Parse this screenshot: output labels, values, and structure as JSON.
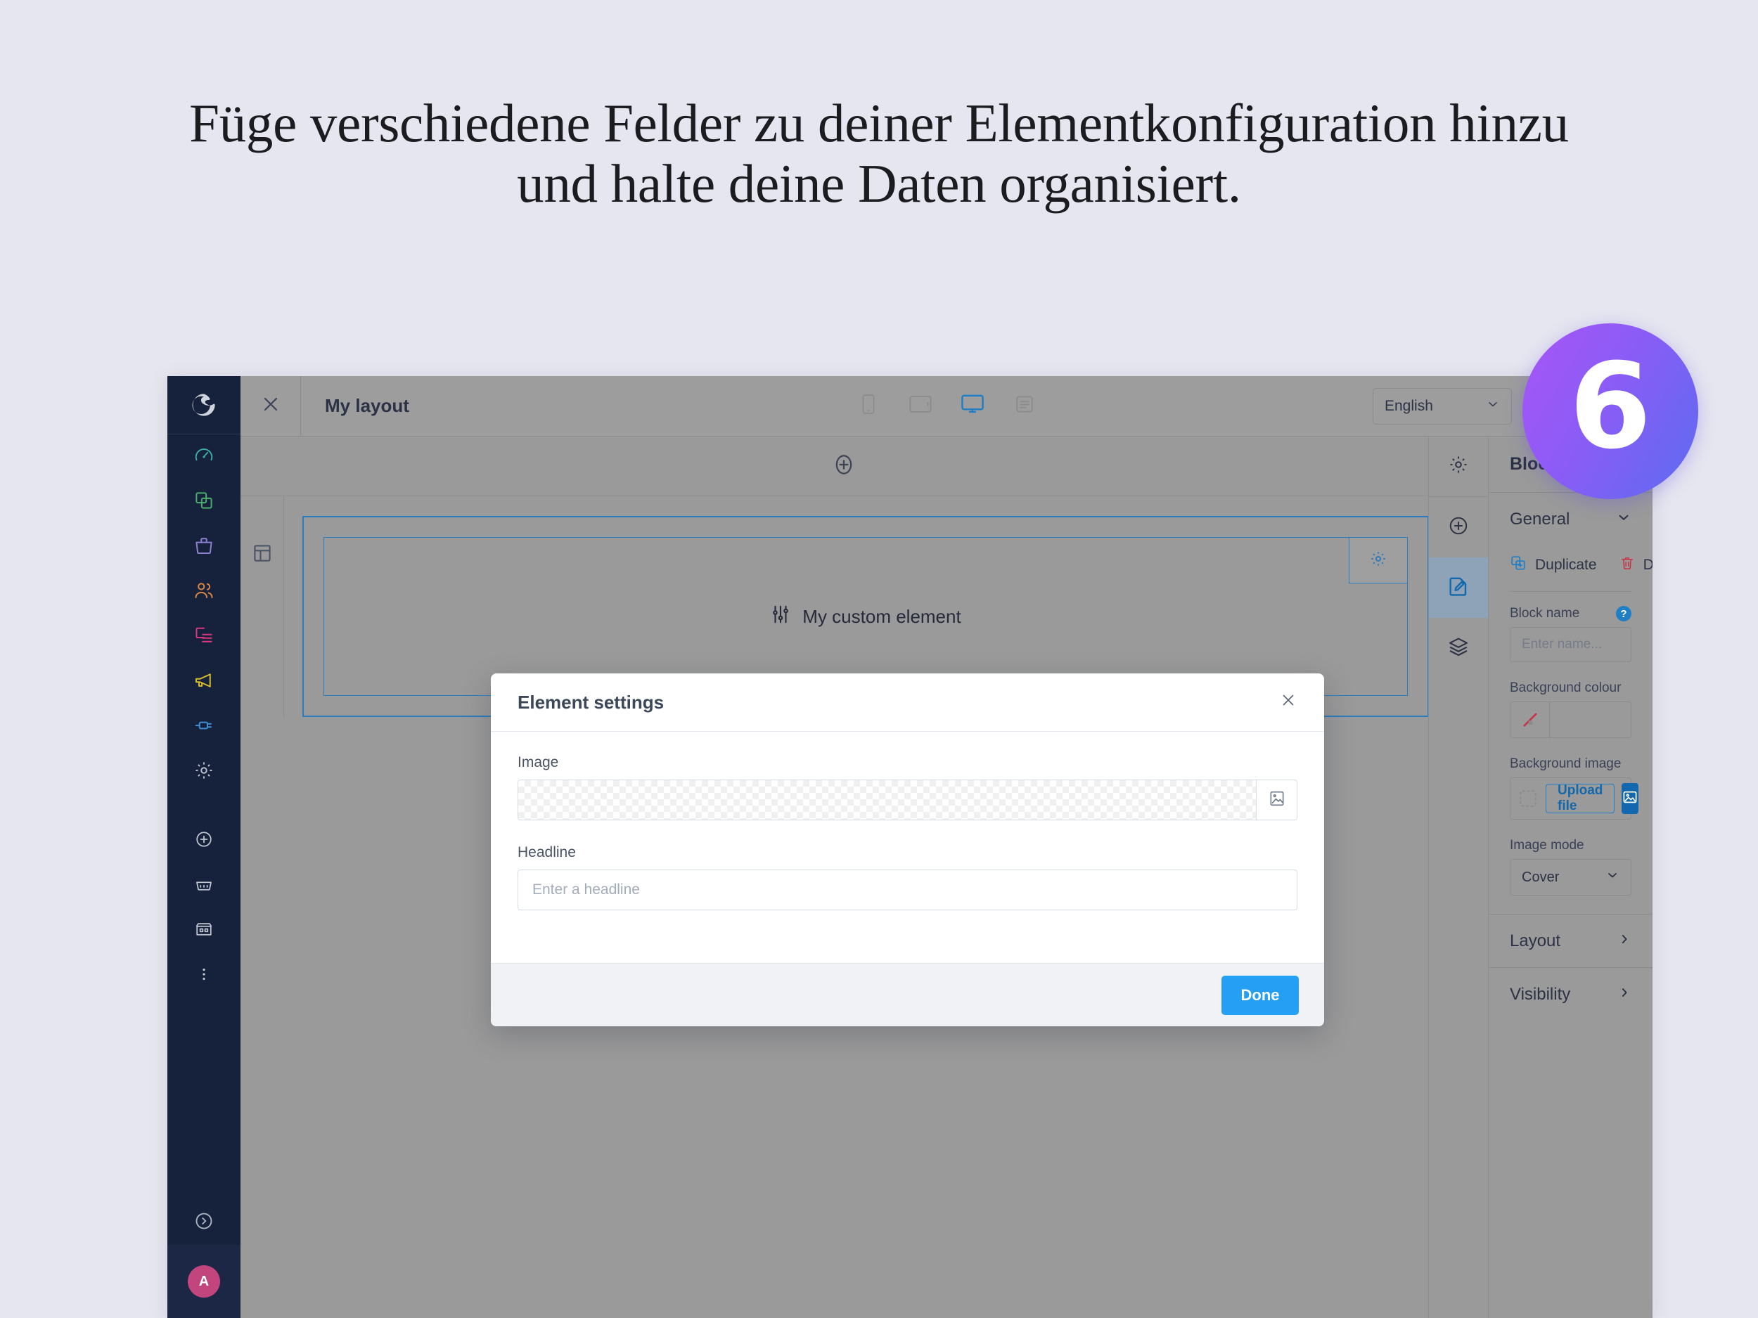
{
  "headline": "Füge verschiedene Felder zu deiner Elementkonfiguration hinzu und halte deine Daten organisiert.",
  "badge": {
    "version": "6"
  },
  "colors": {
    "page_background": "#e6e6f0",
    "sidebar": "#16223c",
    "overlay_grey": "#9a9a9a",
    "accent_blue": "#1f7ec4",
    "primary_button": "#259ff4",
    "save_button": "#0b6db8",
    "danger_red": "#c7344a",
    "avatar": "#c2467d",
    "badge_gradient_from": "#a855f7",
    "badge_gradient_to": "#5b6cf0"
  },
  "sidebar": {
    "logo": "shopware-logo-icon",
    "items": [
      {
        "name": "dashboard",
        "icon": "speedometer-icon",
        "color": "#3ea9a0"
      },
      {
        "name": "catalogues",
        "icon": "copy-icon",
        "color": "#4aab6d"
      },
      {
        "name": "orders",
        "icon": "bag-icon",
        "color": "#8f7fd1"
      },
      {
        "name": "customers",
        "icon": "users-icon",
        "color": "#d98545"
      },
      {
        "name": "content",
        "icon": "content-icon",
        "color": "#d8377f"
      },
      {
        "name": "marketing",
        "icon": "megaphone-icon",
        "color": "#d8bb2e"
      },
      {
        "name": "extensions",
        "icon": "plug-icon",
        "color": "#3f8fd6"
      },
      {
        "name": "settings",
        "icon": "gear-icon",
        "color": "#b9bec9"
      }
    ],
    "quick_actions": [
      {
        "name": "add",
        "icon": "plus-circle-icon"
      },
      {
        "name": "basket",
        "icon": "basket-icon"
      },
      {
        "name": "storefront",
        "icon": "store-icon"
      },
      {
        "name": "more",
        "icon": "more-vertical-icon"
      }
    ],
    "expand": {
      "name": "expand-sidebar",
      "icon": "chevron-right-circle-icon"
    },
    "avatar": {
      "initial": "A"
    }
  },
  "topbar": {
    "close_icon": "close-icon",
    "title": "My layout",
    "devices": [
      {
        "name": "mobile",
        "icon": "mobile-icon",
        "active": false
      },
      {
        "name": "tablet",
        "icon": "tablet-icon",
        "active": false
      },
      {
        "name": "desktop",
        "icon": "desktop-icon",
        "active": true
      },
      {
        "name": "list",
        "icon": "list-view-icon",
        "active": false
      }
    ],
    "language": "English",
    "language_chevron": "chevron-down-icon",
    "save_label": ""
  },
  "canvas": {
    "add_section_icon": "plus-circle-icon",
    "section_icon": "layout-columns-icon",
    "block": {
      "label": "My custom element",
      "element_icon": "sliders-icon",
      "gear_icon": "gear-icon"
    }
  },
  "rail": {
    "items": [
      {
        "name": "section-settings",
        "icon": "gear-icon",
        "active": false
      },
      {
        "name": "add-block",
        "icon": "plus-circle-icon",
        "active": false
      },
      {
        "name": "edit-block",
        "icon": "edit-document-icon",
        "active": true
      },
      {
        "name": "layers",
        "icon": "layers-icon",
        "active": false
      }
    ]
  },
  "panel": {
    "title": "Block settings",
    "general": {
      "label": "General",
      "chevron": "chevron-down-icon",
      "duplicate": {
        "label": "Duplicate",
        "icon": "duplicate-icon"
      },
      "delete": {
        "label": "Delete",
        "icon": "trash-icon"
      }
    },
    "block_name": {
      "label": "Block name",
      "help_icon": "help-icon",
      "help_glyph": "?",
      "placeholder": "Enter name...",
      "value": ""
    },
    "background_colour": {
      "label": "Background colour",
      "swatch": "no-colour-icon",
      "value": ""
    },
    "background_image": {
      "label": "Background image",
      "placeholder_icon": "image-placeholder-icon",
      "upload_label": "Upload file",
      "media_icon": "image-icon"
    },
    "image_mode": {
      "label": "Image mode",
      "value": "Cover",
      "chevron": "chevron-down-icon"
    },
    "collapsibles": [
      {
        "label": "Layout",
        "chevron": "chevron-right-icon"
      },
      {
        "label": "Visibility",
        "chevron": "chevron-right-icon"
      }
    ]
  },
  "modal": {
    "title": "Element settings",
    "close_icon": "close-icon",
    "fields": [
      {
        "label": "Image",
        "type": "image",
        "value": "",
        "button_icon": "image-icon"
      },
      {
        "label": "Headline",
        "type": "text",
        "placeholder": "Enter a headline",
        "value": ""
      }
    ],
    "done_label": "Done"
  }
}
